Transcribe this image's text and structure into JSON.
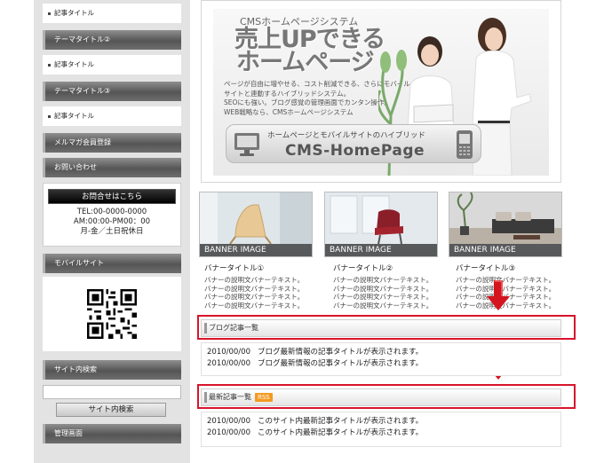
{
  "sidebar": {
    "link1": "記事タイトル",
    "head_theme2": "テーマタイトル②",
    "link2": "記事タイトル",
    "head_theme3": "テーマタイトル③",
    "link3": "記事タイトル",
    "mailmag": "メルマガ会員登録",
    "inquiry": "お問い合わせ",
    "contact_button": "お問合せはこちら",
    "tel": "TEL:00-0000-0000",
    "hours": "AM:00:00-PM00：00",
    "holiday": "月-金／土日祝休日",
    "mobile_site": "モバイルサイト",
    "site_search": "サイト内検索",
    "search_button": "サイト内検索",
    "admin": "管理画面"
  },
  "hero": {
    "subtitle": "CMSホームページシステム",
    "title_line1": "売上UPできる",
    "title_line2": "ホームページ",
    "text_lines": [
      "ページが自由に増やせる、コスト削減できる、さらにモバイル",
      "サイトと連動するハイブリッドシステム。",
      "SEOにも強い。ブログ感覚の管理画面でカンタン操作。",
      "WEB戦略なら、CMSホームページシステム"
    ],
    "bar_top": "ホームページとモバイルサイトのハイブリッド",
    "bar_main": "CMS-HomePage"
  },
  "banners": [
    {
      "caption": "BANNER IMAGE",
      "title": "バナータイトル①",
      "text_lines": [
        "バナーの説明文バナーテキスト。",
        "バナーの説明文バナーテキスト。",
        "バナーの説明文バナーテキスト。",
        "バナーの説明文バナーテキスト。"
      ]
    },
    {
      "caption": "BANNER IMAGE",
      "title": "バナータイトル②",
      "text_lines": [
        "バナーの説明文バナーテキスト。",
        "バナーの説明文バナーテキスト。",
        "バナーの説明文バナーテキスト。",
        "バナーの説明文バナーテキスト。"
      ]
    },
    {
      "caption": "BANNER IMAGE",
      "title": "バナータイトル③",
      "text_lines": [
        "バナーの説明文バナーテキスト。",
        "バナーの説明文バナーテキスト。",
        "バナーの説明文バナーテキスト。",
        "バナーの説明文バナーテキスト。"
      ]
    }
  ],
  "blog": {
    "heading": "ブログ記事一覧",
    "items": [
      {
        "date": "2010/00/00",
        "title": "ブログ最新情報の記事タイトルが表示されます。"
      },
      {
        "date": "2010/00/00",
        "title": "ブログ最新情報の記事タイトルが表示されます。"
      }
    ]
  },
  "latest": {
    "heading": "最新記事一覧",
    "rss": "RSS",
    "items": [
      {
        "date": "2010/00/00",
        "title": "このサイト内最新記事タイトルが表示されます。"
      },
      {
        "date": "2010/00/00",
        "title": "このサイト内最新記事タイトルが表示されます。"
      }
    ]
  },
  "colors": {
    "highlight_red": "#d9142b",
    "rss_orange": "#f39a1f"
  }
}
